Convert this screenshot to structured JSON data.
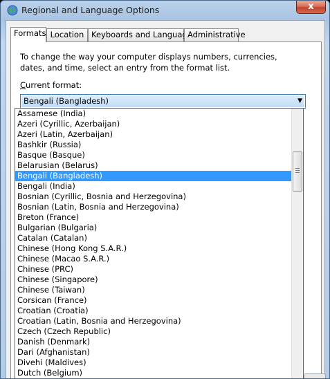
{
  "window": {
    "title": "Regional and Language Options",
    "close_glyph": "x"
  },
  "tabs": [
    {
      "label": "Formats"
    },
    {
      "label": "Location"
    },
    {
      "label": "Keyboards and Languages"
    },
    {
      "label": "Administrative"
    }
  ],
  "formats": {
    "intro": "To change the way your computer displays numbers, currencies, dates, and time, select an entry from the format list.",
    "current_format_label_accel": "C",
    "current_format_label_rest": "urrent format:",
    "current_format_value": "Bengali (Bangladesh)"
  },
  "dropdown": {
    "selected_index": 6,
    "scroll_position": "partial, near upper third",
    "items": [
      "Assamese (India)",
      "Azeri (Cyrillic, Azerbaijan)",
      "Azeri (Latin, Azerbaijan)",
      "Bashkir (Russia)",
      "Basque (Basque)",
      "Belarusian (Belarus)",
      "Bengali (Bangladesh)",
      "Bengali (India)",
      "Bosnian (Cyrillic, Bosnia and Herzegovina)",
      "Bosnian (Latin, Bosnia and Herzegovina)",
      "Breton (France)",
      "Bulgarian (Bulgaria)",
      "Catalan (Catalan)",
      "Chinese (Hong Kong S.A.R.)",
      "Chinese (Macao S.A.R.)",
      "Chinese (PRC)",
      "Chinese (Singapore)",
      "Chinese (Taiwan)",
      "Corsican (France)",
      "Croatian (Croatia)",
      "Croatian (Latin, Bosnia and Herzegovina)",
      "Czech (Czech Republic)",
      "Danish (Denmark)",
      "Dari (Afghanistan)",
      "Divehi (Maldives)",
      "Dutch (Belgium)"
    ]
  },
  "icons": {
    "title": "globe-icon",
    "combo_arrow": "chevron-down-icon",
    "close": "close-icon"
  },
  "colors": {
    "selection": "#3399ff",
    "close_button": "#c4432a",
    "title_bar": "#a9c4e3"
  }
}
